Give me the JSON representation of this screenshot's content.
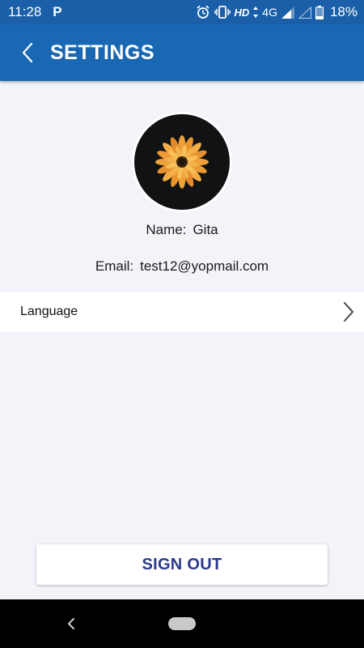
{
  "status_bar": {
    "time": "11:28",
    "notification": "P",
    "network_label": "HD",
    "network_type": "4G",
    "battery": "18%",
    "icons": [
      "alarm-icon",
      "vibrate-icon",
      "data-arrows-icon",
      "signal-icon",
      "signal-empty-icon",
      "battery-icon"
    ]
  },
  "app_bar": {
    "title": "SETTINGS",
    "back_icon": "chevron-left-icon"
  },
  "profile": {
    "avatar_icon": "flower-avatar",
    "name_label": "Name:",
    "name_value": "Gita",
    "email_label": "Email:",
    "email_value": "test12@yopmail.com"
  },
  "settings_rows": [
    {
      "label": "Language",
      "icon": "chevron-right-icon"
    }
  ],
  "sign_out": {
    "label": "SIGN OUT"
  },
  "nav_bar": {
    "back_icon": "nav-back-icon",
    "home_icon": "nav-home-pill"
  },
  "colors": {
    "primary": "#1a67b3",
    "status_bar": "#1a5fa8",
    "background": "#f2f4fa",
    "sign_out_text": "#2a3a8c"
  }
}
